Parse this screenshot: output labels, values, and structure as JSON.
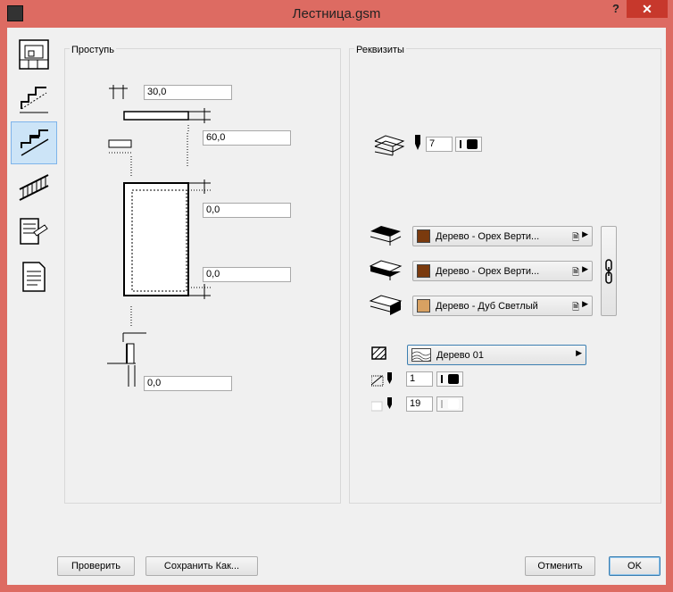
{
  "window": {
    "title": "Лестница.gsm",
    "help": "?",
    "close": "✕"
  },
  "sidebar": {
    "tabs": [
      {
        "name": "tab-plan-icon"
      },
      {
        "name": "tab-stair-3d-icon"
      },
      {
        "name": "tab-tread-icon"
      },
      {
        "name": "tab-railing-icon"
      },
      {
        "name": "tab-listing-icon"
      },
      {
        "name": "tab-document-icon"
      }
    ]
  },
  "left_panel": {
    "title": "Проступь",
    "values": {
      "top_offset": "30,0",
      "height": "60,0",
      "inset_top": "0,0",
      "inset_bottom": "0,0",
      "bottom_offset": "0,0"
    }
  },
  "right_panel": {
    "title": "Реквизиты",
    "pen_number": "7",
    "materials": [
      {
        "label": "Дерево - Орех Верти...",
        "color": "#7a3a0e"
      },
      {
        "label": "Дерево - Орех Верти...",
        "color": "#7a3a0e"
      },
      {
        "label": "Дерево - Дуб Светлый",
        "color": "#d8a162"
      }
    ],
    "fill": {
      "label": "Дерево 01"
    },
    "fill_pen": "1",
    "background_pen": "19"
  },
  "footer": {
    "check": "Проверить",
    "save_as": "Сохранить Как...",
    "cancel": "Отменить",
    "ok": "OK"
  }
}
